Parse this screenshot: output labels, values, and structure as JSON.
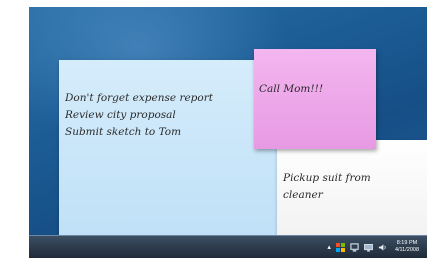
{
  "notes": {
    "blue": {
      "lines": [
        "Don't forget expense report",
        "Review city proposal",
        "Submit sketch to Tom"
      ],
      "color": "#c9e6f9"
    },
    "pink": {
      "lines": [
        "Call Mom!!!"
      ],
      "color": "#eca6e8"
    },
    "white": {
      "lines": [
        "Pickup suit from",
        "cleaner"
      ],
      "color": "#f6f6f6"
    }
  },
  "taskbar": {
    "tray_icons": [
      "show-hidden-icons-icon",
      "action-center-flag-icon",
      "network-icon",
      "display-icon",
      "volume-icon"
    ],
    "clock_time": "8:19 PM",
    "clock_date": "4/11/2008"
  },
  "colors": {
    "desktop": "#1c5c95",
    "taskbar": "#26323f"
  }
}
